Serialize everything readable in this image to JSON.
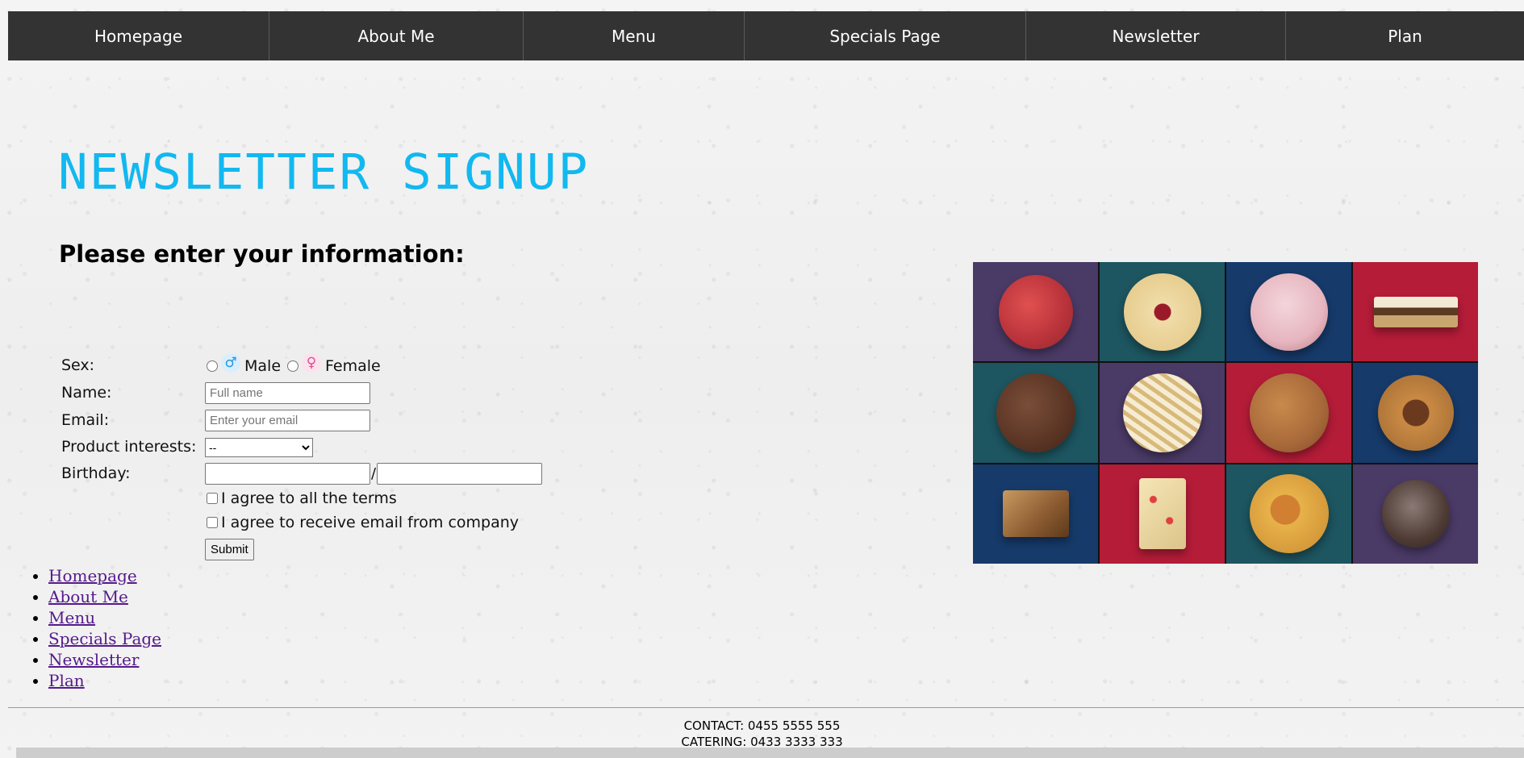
{
  "nav": {
    "items": [
      "Homepage",
      "About Me",
      "Menu",
      "Specials Page",
      "Newsletter",
      "Plan"
    ]
  },
  "page": {
    "title": "NEWSLETTER SIGNUP",
    "subtitle": "Please enter your information:"
  },
  "form": {
    "sex_label": "Sex:",
    "male_symbol": "♂",
    "male_label": "Male",
    "female_symbol": "♀",
    "female_label": "Female",
    "name_label": "Name:",
    "name_placeholder": "Full name",
    "email_label": "Email:",
    "email_placeholder": "Enter your email",
    "interests_label": "Product interests:",
    "interests_selected": "--",
    "birthday_label": "Birthday:",
    "birthday_separator": "/",
    "terms_label": "I agree to all the terms",
    "email_consent_label": "I agree to receive email from company",
    "submit_label": "Submit"
  },
  "list_nav": {
    "items": [
      "Homepage",
      "About Me",
      "Menu",
      "Specials Page",
      "Newsletter",
      "Plan"
    ]
  },
  "footer": {
    "contact": "CONTACT: 0455 5555 555",
    "catering": "CATERING: 0433 3333 333"
  },
  "image": {
    "description_icon": "cookie-grid-image"
  }
}
